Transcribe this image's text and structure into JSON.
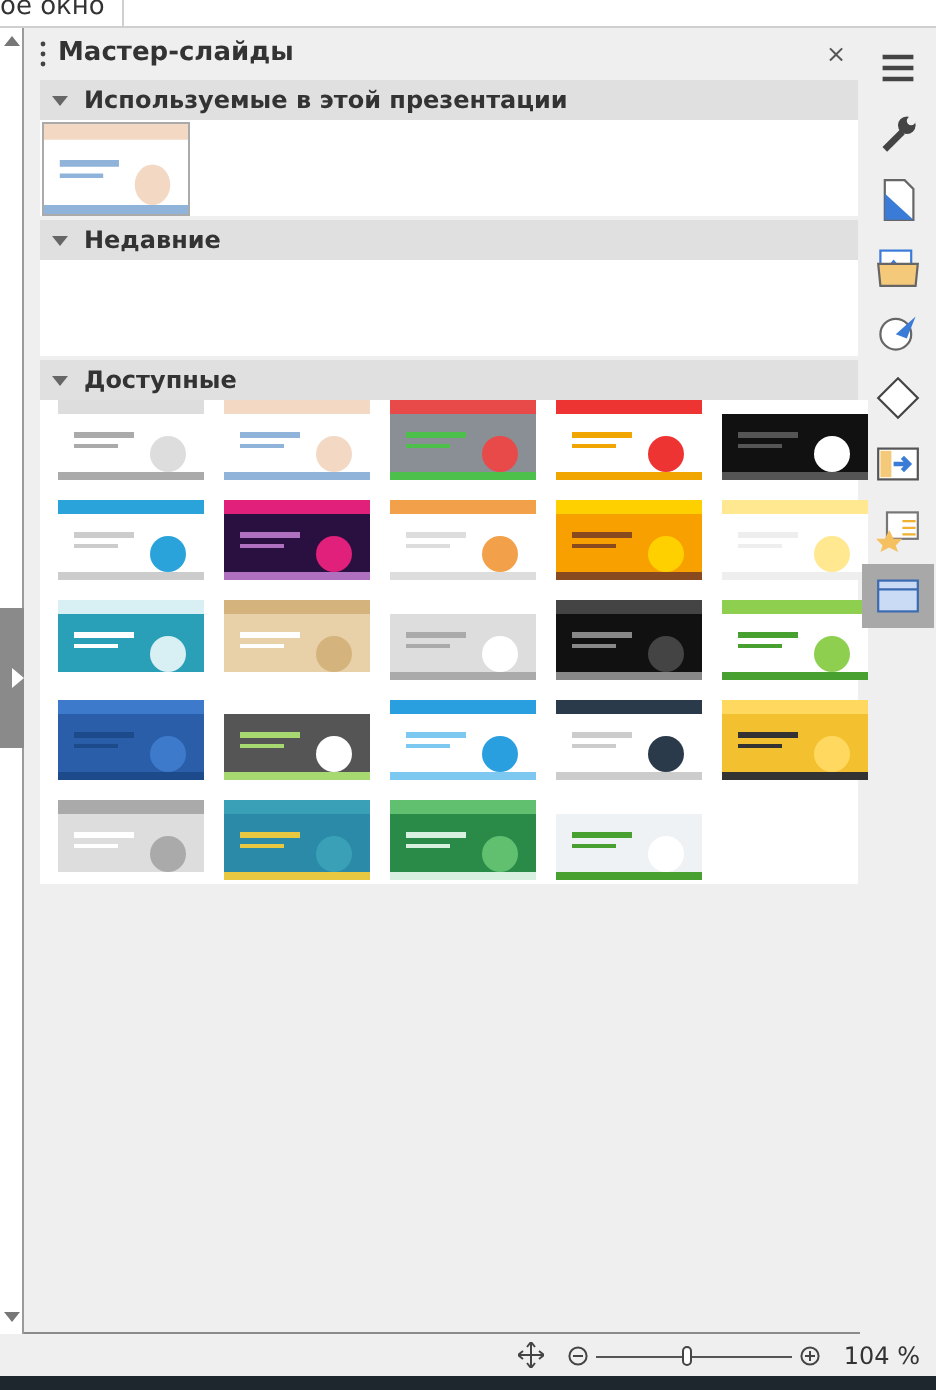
{
  "top_fragment": "ое окно",
  "panel": {
    "title": "Мастер-слайды",
    "close": "×"
  },
  "sections": [
    {
      "title": "Используемые в этой презентации",
      "expanded": true
    },
    {
      "title": "Недавние",
      "expanded": true
    },
    {
      "title": "Доступные",
      "expanded": true
    }
  ],
  "tabbar": [
    {
      "selected": false
    },
    {
      "selected": false
    },
    {
      "selected": false
    },
    {
      "selected": false
    },
    {
      "selected": false
    },
    {
      "selected": false
    },
    {
      "selected": false
    },
    {
      "selected": false
    },
    {
      "selected": true
    }
  ],
  "status_bar": {
    "zoom": {
      "level": 0.46
    },
    "zoom_text": "104 %"
  }
}
